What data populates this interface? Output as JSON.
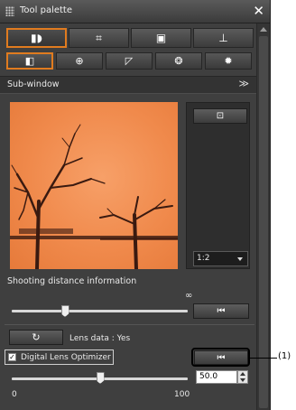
{
  "window": {
    "title": "Tool palette",
    "close": "✕"
  },
  "tabs_top": [
    {
      "name": "tab-basic-adjustment",
      "icon": "▮◗"
    },
    {
      "name": "tab-crop",
      "icon": "⌗"
    },
    {
      "name": "tab-image",
      "icon": "▣"
    },
    {
      "name": "tab-stamp",
      "icon": "⊥"
    }
  ],
  "tabs_bottom": [
    {
      "name": "tab-tone",
      "icon": "◧"
    },
    {
      "name": "tab-nr",
      "icon": "⊕"
    },
    {
      "name": "tab-curve",
      "icon": "◸"
    },
    {
      "name": "tab-color",
      "icon": "❂"
    },
    {
      "name": "tab-settings",
      "icon": "✹"
    }
  ],
  "subwindow": {
    "label": "Sub-window",
    "chevron": "≫",
    "zoom": "1:2",
    "fit_icon": "⊡"
  },
  "shooting": {
    "label": "Shooting distance information",
    "infinity": "∞",
    "slider_fraction": 0.3,
    "reset_icon": "⏮"
  },
  "lens": {
    "refresh_icon": "↻",
    "label": "Lens data : Yes"
  },
  "dlo": {
    "checkbox_label": "Digital Lens Optimizer",
    "checked": true,
    "reset_icon": "⏮",
    "value": "50.0",
    "min": "0",
    "max": "100",
    "slider_fraction": 0.5
  },
  "callout": "(1)",
  "colors": {
    "accent": "#e07b1f",
    "background": "#3f3f3f",
    "preview": "#f08a4c"
  }
}
